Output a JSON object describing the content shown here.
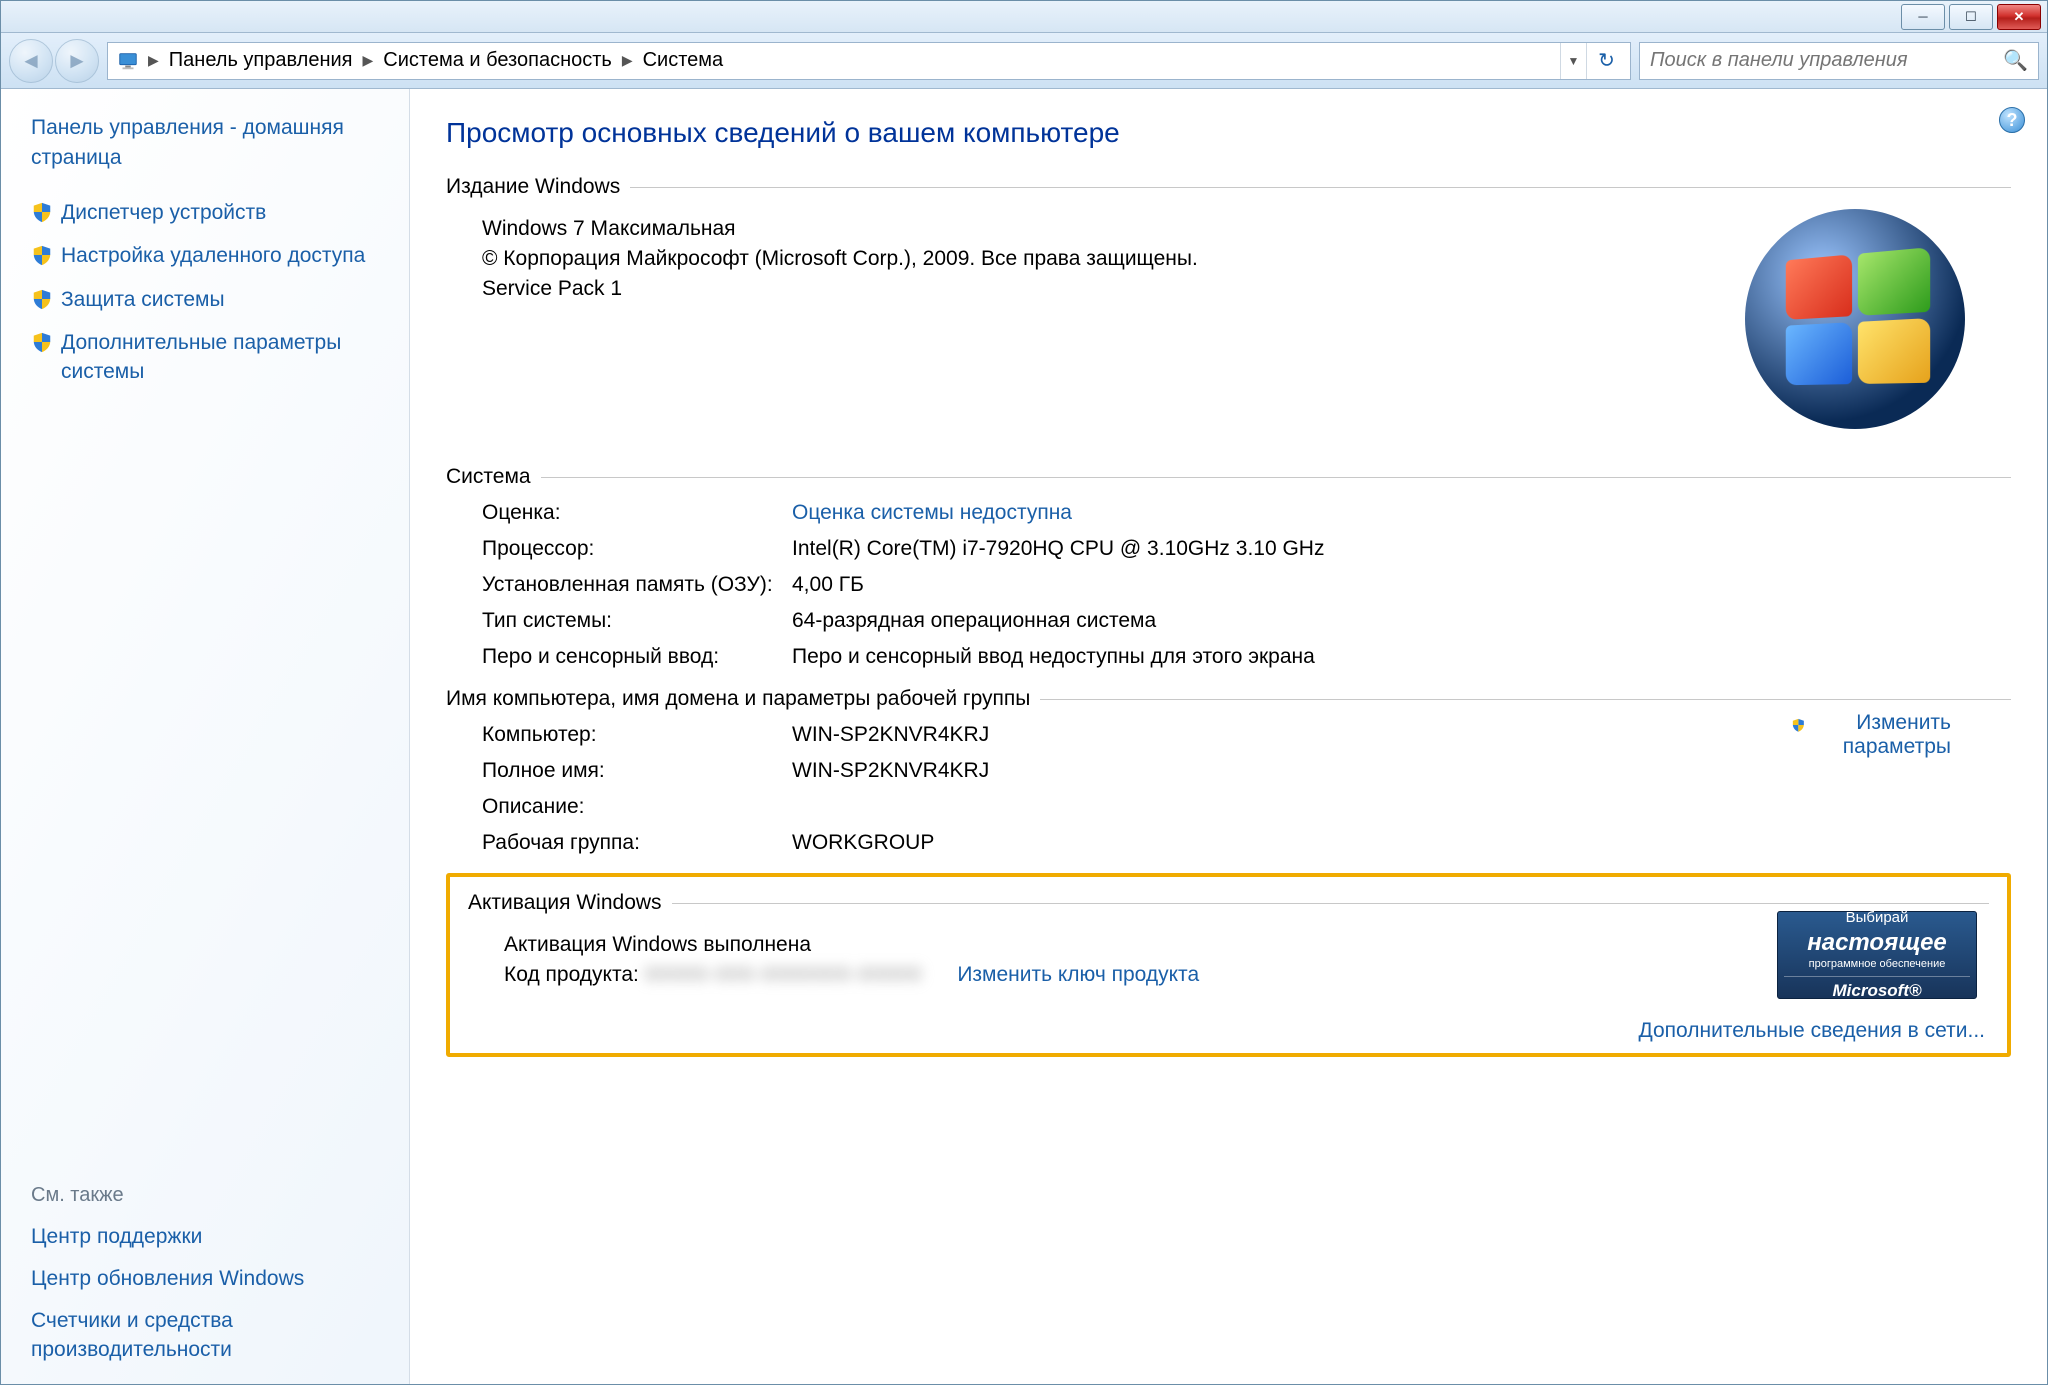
{
  "breadcrumb": {
    "items": [
      "Панель управления",
      "Система и безопасность",
      "Система"
    ]
  },
  "search": {
    "placeholder": "Поиск в панели управления"
  },
  "sidebar": {
    "home": "Панель управления - домашняя страница",
    "tasks": [
      "Диспетчер устройств",
      "Настройка удаленного доступа",
      "Защита системы",
      "Дополнительные параметры системы"
    ],
    "see_also_header": "См. также",
    "see_also": [
      "Центр поддержки",
      "Центр обновления Windows",
      "Счетчики и средства производительности"
    ]
  },
  "main": {
    "title": "Просмотр основных сведений о вашем компьютере",
    "edition": {
      "legend": "Издание Windows",
      "name": "Windows 7 Максимальная",
      "copyright": "© Корпорация Майкрософт (Microsoft Corp.), 2009. Все права защищены.",
      "sp": "Service Pack 1"
    },
    "system": {
      "legend": "Система",
      "rows": {
        "rating_k": "Оценка:",
        "rating_v": "Оценка системы недоступна",
        "cpu_k": "Процессор:",
        "cpu_v": "Intel(R) Core(TM) i7-7920HQ CPU @ 3.10GHz   3.10 GHz",
        "ram_k": "Установленная память (ОЗУ):",
        "ram_v": "4,00 ГБ",
        "type_k": "Тип системы:",
        "type_v": "64-разрядная операционная система",
        "pen_k": "Перо и сенсорный ввод:",
        "pen_v": "Перо и сенсорный ввод недоступны для этого экрана"
      }
    },
    "computer": {
      "legend": "Имя компьютера, имя домена и параметры рабочей группы",
      "rows": {
        "name_k": "Компьютер:",
        "name_v": "WIN-SP2KNVR4KRJ",
        "full_k": "Полное имя:",
        "full_v": "WIN-SP2KNVR4KRJ",
        "desc_k": "Описание:",
        "desc_v": "",
        "wg_k": "Рабочая группа:",
        "wg_v": "WORKGROUP"
      },
      "change_link": "Изменить параметры"
    },
    "activation": {
      "legend": "Активация Windows",
      "status": "Активация Windows выполнена",
      "pid_label": "Код продукта: ",
      "pid_value": "00000-000-0000000-00000",
      "change_key": "Изменить ключ продукта",
      "genuine": {
        "line1": "Выбирай",
        "line2": "настоящее",
        "line3": "программное обеспечение",
        "line4": "Microsoft®"
      },
      "net_link": "Дополнительные сведения в сети..."
    }
  }
}
